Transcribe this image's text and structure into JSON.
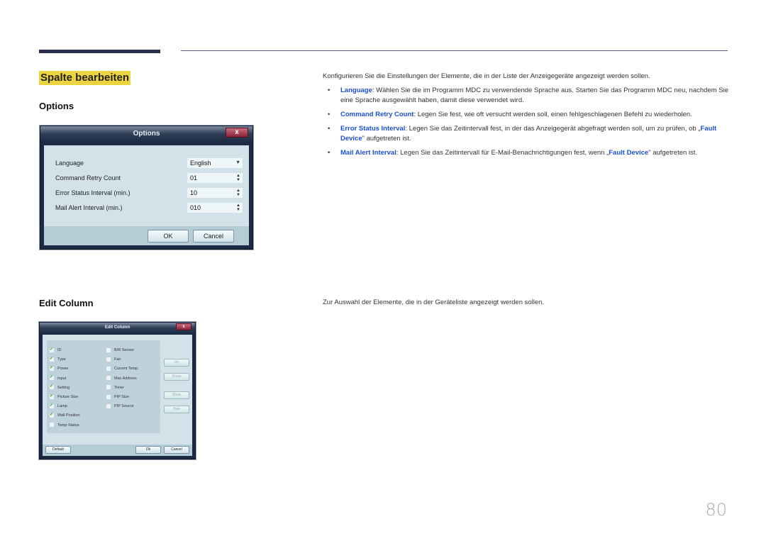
{
  "section": {
    "title": "Spalte bearbeiten"
  },
  "options": {
    "heading": "Options",
    "dialog": {
      "title": "Options",
      "close_label": "x",
      "rows": [
        {
          "label": "Language",
          "value": "English",
          "control": "dropdown"
        },
        {
          "label": "Command Retry Count",
          "value": "01",
          "control": "spinner"
        },
        {
          "label": "Error Status Interval (min.)",
          "value": "10",
          "control": "spinner"
        },
        {
          "label": "Mail Alert Interval (min.)",
          "value": "010",
          "control": "spinner"
        }
      ],
      "ok_label": "OK",
      "cancel_label": "Cancel"
    },
    "intro": "Konfigurieren Sie die Einstellungen der Elemente, die in der Liste der Anzeigegeräte angezeigt werden sollen.",
    "bullets": [
      {
        "term": "Language",
        "text": ": Wählen Sie die im Programm MDC zu verwendende Sprache aus. Starten Sie das Programm MDC neu, nachdem Sie eine Sprache ausgewählt haben, damit diese verwendet wird."
      },
      {
        "term": "Command Retry Count",
        "text": ": Legen Sie fest, wie oft versucht werden soll, einen fehlgeschlagenen Befehl zu wiederholen."
      },
      {
        "term": "Error Status Interval",
        "text": ": Legen Sie das Zeitintervall fest, in der das Anzeigegerät abgefragt werden soll, um zu prüfen, ob „",
        "term2": "Fault Device",
        "text2": "\" aufgetreten ist."
      },
      {
        "term": "Mail Alert Interval",
        "text": ": Legen Sie das Zeitintervall für E-Mail-Benachrichtigungen fest, wenn „",
        "term2": "Fault Device",
        "text2": "\" aufgetreten ist."
      }
    ],
    "bullet_glyph": "•"
  },
  "edit_column": {
    "heading": "Edit Column",
    "description": "Zur Auswahl der Elemente, die in der Geräteliste angezeigt werden sollen.",
    "dialog": {
      "title": "Edit Column",
      "close_label": "x",
      "left_items": [
        {
          "label": "ID",
          "checked": true
        },
        {
          "label": "Type",
          "checked": true
        },
        {
          "label": "Power",
          "checked": true
        },
        {
          "label": "Input",
          "checked": true
        },
        {
          "label": "Setting",
          "checked": true
        },
        {
          "label": "Picture Size",
          "checked": true
        },
        {
          "label": "Lamp",
          "checked": true
        },
        {
          "label": "Wall Position",
          "checked": true
        },
        {
          "label": "Temp Status",
          "checked": false
        }
      ],
      "right_items": [
        {
          "label": "B/R Sensor",
          "checked": false
        },
        {
          "label": "Fan",
          "checked": false
        },
        {
          "label": "Current Temp.",
          "checked": false
        },
        {
          "label": "Mac Address",
          "checked": false
        },
        {
          "label": "Timer",
          "checked": false
        },
        {
          "label": "PIP Size",
          "checked": false
        },
        {
          "label": "PIP Source",
          "checked": false
        }
      ],
      "side_buttons": [
        "Up",
        "Down",
        "Show",
        "Hide"
      ],
      "default_label": "Default",
      "ok_label": "Ok",
      "cancel_label": "Cancel"
    }
  },
  "page_number": "80"
}
